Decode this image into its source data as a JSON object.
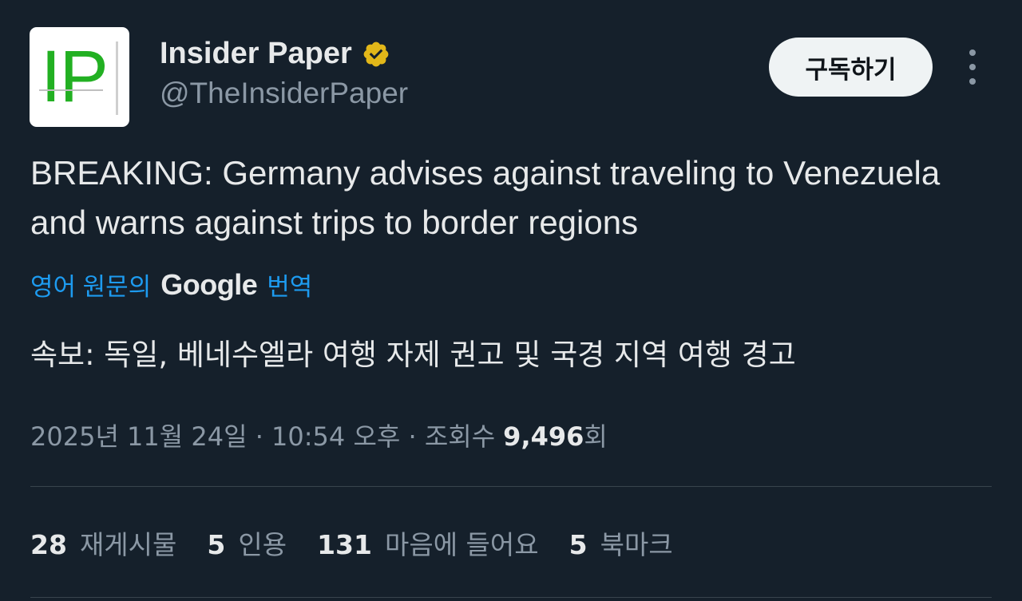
{
  "author": {
    "avatar_text": "IP",
    "display_name": "Insider Paper",
    "handle": "@TheInsiderPaper",
    "verified_icon": "verified-badge-icon",
    "verified_color": "#e2b719"
  },
  "actions": {
    "subscribe_label": "구독하기",
    "more_icon": "more-vertical-icon"
  },
  "tweet": {
    "text": "BREAKING: Germany advises against traveling to Venezuela and warns against trips to border regions",
    "translate_prefix": "영어 원문의",
    "translate_brand": "Google",
    "translate_suffix": "번역",
    "translated_text": "속보: 독일, 베네수엘라 여행 자제 권고 및 국경 지역 여행 경고"
  },
  "meta": {
    "timestamp": "2025년 11월 24일 · 10:54 오후 · 조회수",
    "views": "9,496",
    "views_suffix": "회"
  },
  "stats": [
    {
      "count": "28",
      "label": "재게시물"
    },
    {
      "count": "5",
      "label": "인용"
    },
    {
      "count": "131",
      "label": "마음에 들어요"
    },
    {
      "count": "5",
      "label": "북마크"
    }
  ],
  "colors": {
    "background": "#15202b",
    "primary_text": "#e7e9ea",
    "secondary_text": "#8b98a5",
    "link": "#1d9bf0",
    "button_bg": "#eff3f4"
  }
}
